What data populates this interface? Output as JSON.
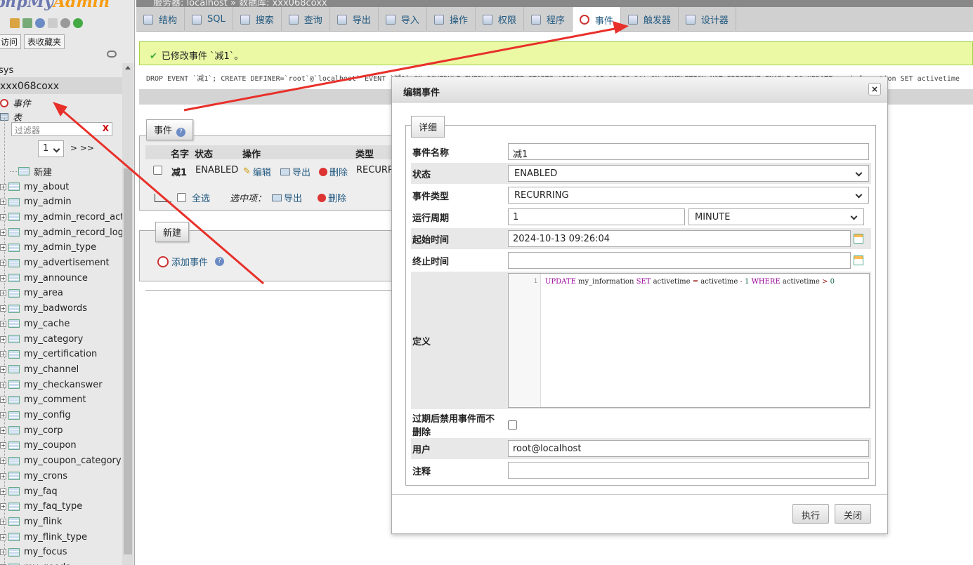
{
  "logo": {
    "php": "phpMy",
    "admin": "Admin"
  },
  "sidebar": {
    "tabs": [
      "访问",
      "表收藏夹"
    ],
    "db_sys": "sys",
    "db_current": "xxx068coxx",
    "events_node": "事件",
    "tables_node": "表",
    "filter_placeholder": "过滤器",
    "filter_clear": "X",
    "page_select": "1",
    "page_next": "> >>",
    "new_label": "新建",
    "tables": [
      "my_about",
      "my_admin",
      "my_admin_record_act",
      "my_admin_record_log",
      "my_admin_type",
      "my_advertisement",
      "my_announce",
      "my_area",
      "my_badwords",
      "my_cache",
      "my_category",
      "my_certification",
      "my_channel",
      "my_checkanswer",
      "my_comment",
      "my_config",
      "my_corp",
      "my_coupon",
      "my_coupon_category",
      "my_crons",
      "my_faq",
      "my_faq_type",
      "my_flink",
      "my_flink_type",
      "my_focus",
      "my_goods"
    ]
  },
  "breadcrumb": "服务器: localhost » 数据库: xxx068coxx",
  "nav": {
    "tabs": [
      {
        "label": "结构",
        "icon": "structure-icon"
      },
      {
        "label": "SQL",
        "icon": "sql-icon"
      },
      {
        "label": "搜索",
        "icon": "search-icon"
      },
      {
        "label": "查询",
        "icon": "query-icon"
      },
      {
        "label": "导出",
        "icon": "export-icon"
      },
      {
        "label": "导入",
        "icon": "import-icon"
      },
      {
        "label": "操作",
        "icon": "wrench-icon"
      },
      {
        "label": "权限",
        "icon": "privileges-icon"
      },
      {
        "label": "程序",
        "icon": "routines-icon"
      },
      {
        "label": "事件",
        "icon": "clock-icon"
      },
      {
        "label": "触发器",
        "icon": "triggers-icon"
      },
      {
        "label": "设计器",
        "icon": "designer-icon"
      }
    ],
    "active": "事件"
  },
  "success_msg": "已修改事件 `减1`。",
  "sql_text": "DROP EVENT `减1`; CREATE DEFINER=`root`@`localhost` EVENT `减1` ON SCHEDULE EVERY 1 MINUTE STARTS '2024-10-13 09:26:04' ON COMPLETION NOT PRESERVE ENABLE DO UPDATE my_information SET activetime",
  "events_panel": {
    "legend": "事件",
    "headers": [
      "名字",
      "状态",
      "操作",
      "类型"
    ],
    "row": {
      "name": "减1",
      "status": "ENABLED",
      "edit": "编辑",
      "export": "导出",
      "delete": "删除",
      "type": "RECURR"
    },
    "select_all": "全选",
    "selected_label": "选中项：",
    "bulk_export": "导出",
    "bulk_delete": "删除"
  },
  "new_panel": {
    "legend": "新建",
    "add_event": "添加事件"
  },
  "dialog": {
    "title": "编辑事件",
    "close": "×",
    "legend": "详细",
    "fields": {
      "name_label": "事件名称",
      "name_value": "减1",
      "status_label": "状态",
      "status_value": "ENABLED",
      "type_label": "事件类型",
      "type_value": "RECURRING",
      "interval_label": "运行周期",
      "interval_value": "1",
      "interval_unit": "MINUTE",
      "start_label": "起始时间",
      "start_value": "2024-10-13 09:26:04",
      "end_label": "终止时间",
      "end_value": "",
      "definition_label": "定义",
      "definition_line_no": "1",
      "definition": "UPDATE my_information SET activetime = activetime - 1 WHERE activetime > 0",
      "preserve_label": "过期后禁用事件而不删除",
      "user_label": "用户",
      "user_value": "root@localhost",
      "comment_label": "注释",
      "comment_value": ""
    },
    "execute": "执行",
    "cancel": "关闭"
  },
  "colors": {
    "arrow": "#e8302a",
    "success_bg": "#ebf8a4",
    "link": "#235a81"
  }
}
